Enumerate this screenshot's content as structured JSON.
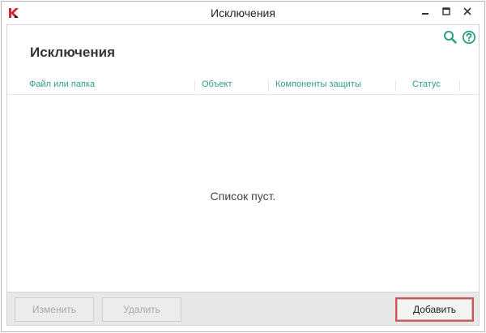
{
  "window": {
    "title": "Исключения"
  },
  "page": {
    "title": "Исключения",
    "empty_message": "Список пуст."
  },
  "table": {
    "columns": [
      "Файл или папка",
      "Объект",
      "Компоненты защиты",
      "Статус"
    ]
  },
  "toolbar": {
    "edit_label": "Изменить",
    "delete_label": "Удалить",
    "add_label": "Добавить"
  },
  "icons": {
    "app": "kaspersky-logo-icon",
    "search": "search-icon",
    "help": "help-icon",
    "minimize": "minimize-icon",
    "maximize": "maximize-icon",
    "close": "close-icon"
  },
  "colors": {
    "accent": "#2e9e85",
    "brand_red": "#d6262b",
    "highlight_border": "#d9534f"
  }
}
